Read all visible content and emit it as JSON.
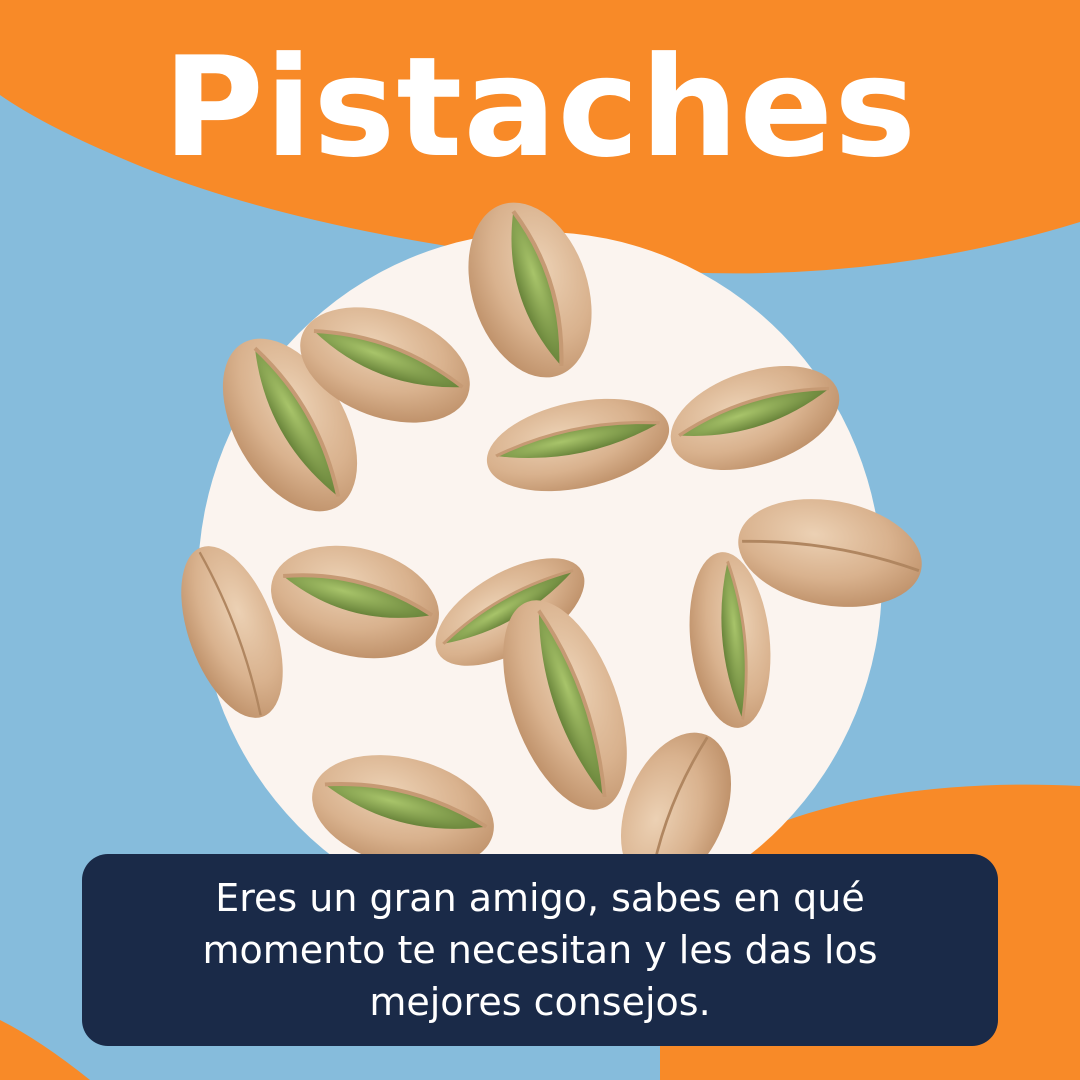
{
  "title": "Pistaches",
  "caption": "Eres un gran amigo, sabes en qué momento te necesitan y les das los mejores consejos.",
  "colors": {
    "orange": "#f88a28",
    "sky_blue": "#86bcdc",
    "cream": "#fbf4ef",
    "navy": "#1a2a48",
    "text": "#ffffff"
  },
  "image": {
    "subject": "pistachio-nuts",
    "count": 13
  }
}
